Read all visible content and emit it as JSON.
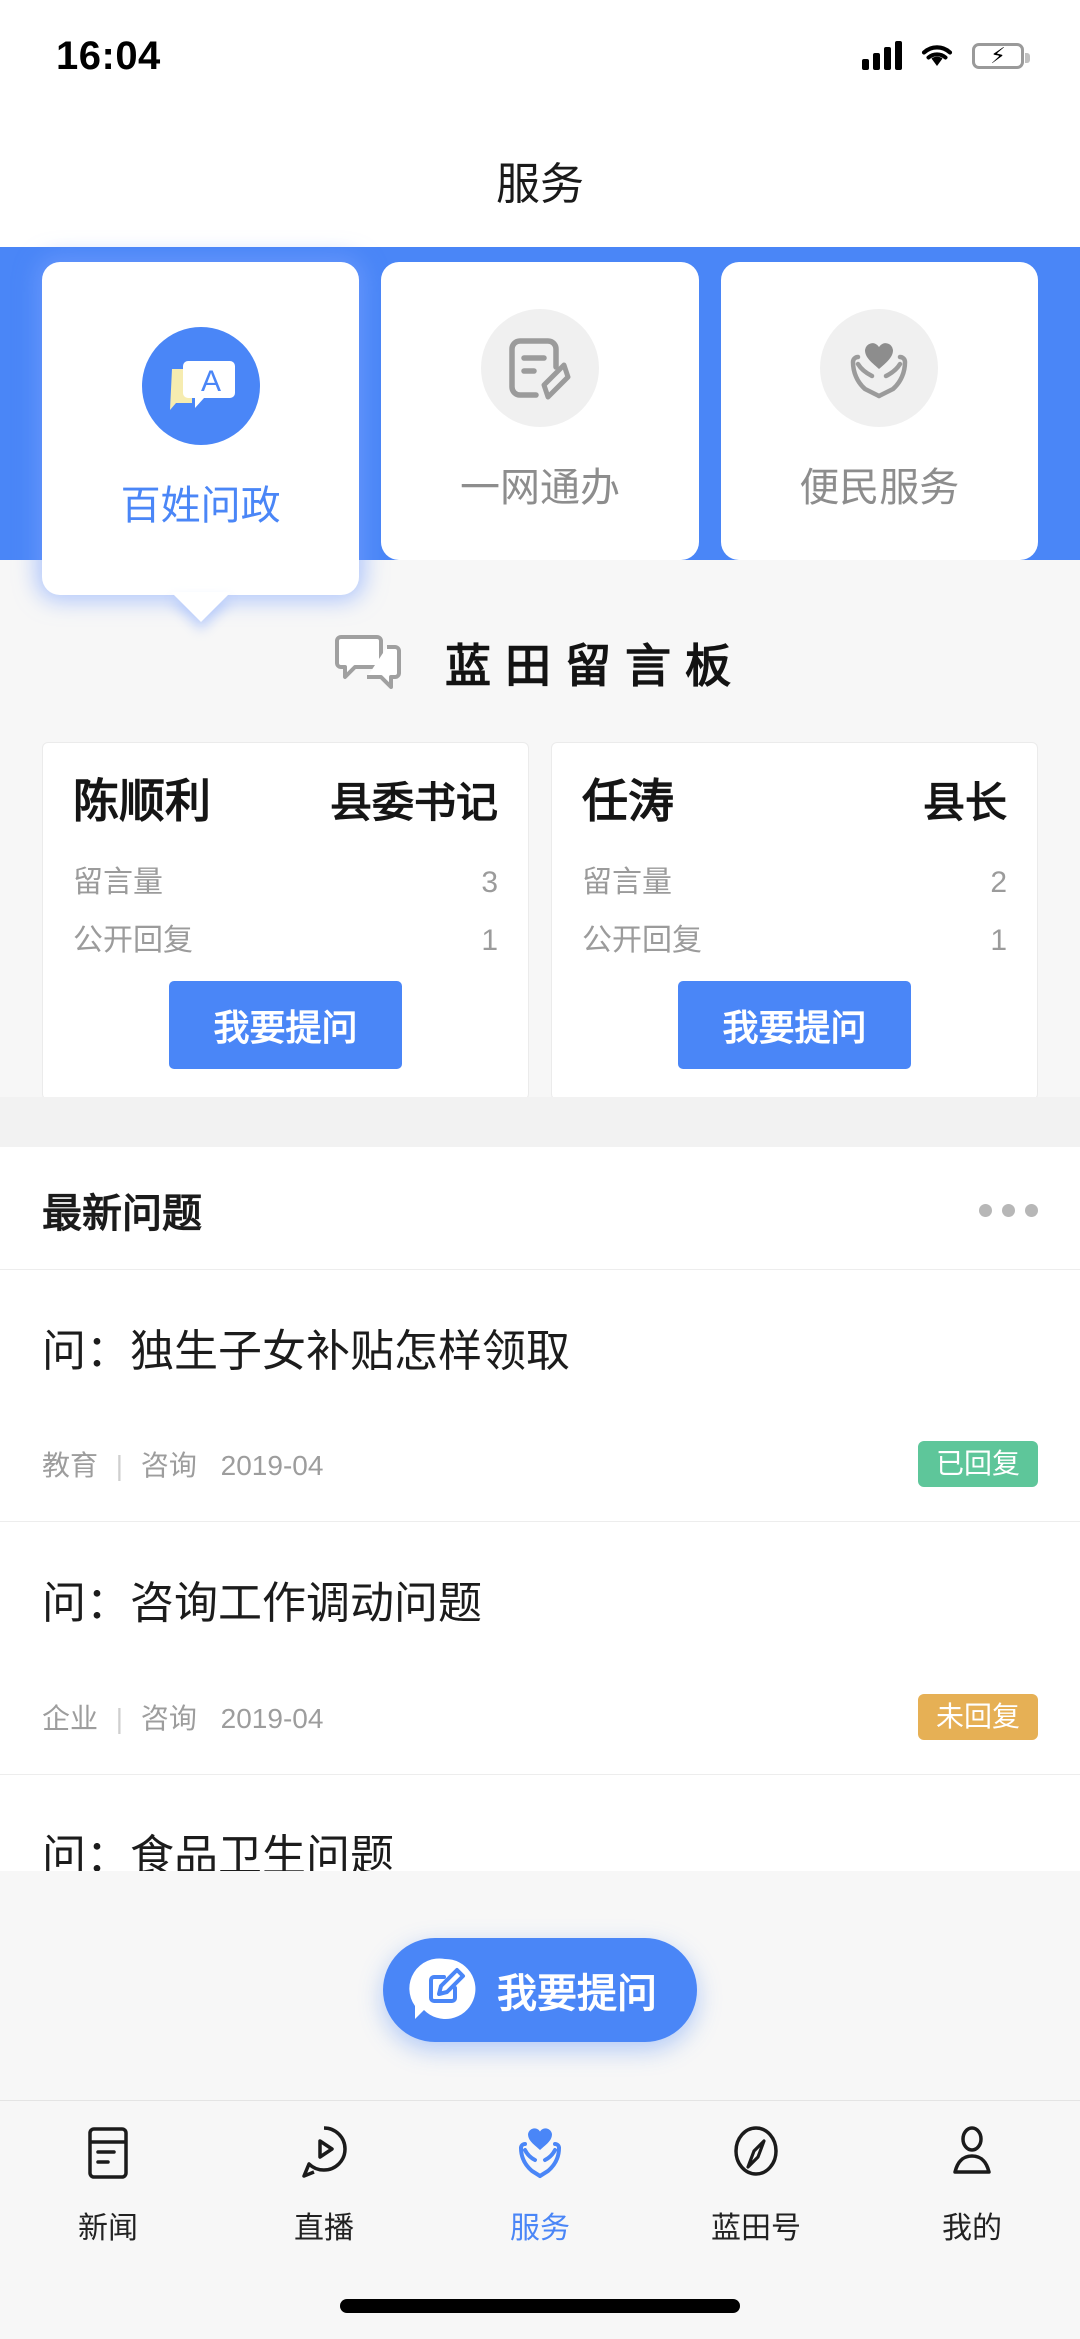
{
  "status_bar": {
    "time": "16:04",
    "signal_icon": "cellular-bars-icon",
    "wifi_icon": "wifi-icon",
    "battery_icon": "battery-charging-icon"
  },
  "nav": {
    "title": "服务"
  },
  "service_tabs": [
    {
      "label": "百姓问政",
      "icon": "speech-bubble-a-icon",
      "active": true
    },
    {
      "label": "一网通办",
      "icon": "document-pen-icon",
      "active": false
    },
    {
      "label": "便民服务",
      "icon": "heart-in-hands-icon",
      "active": false
    }
  ],
  "board": {
    "icon": "dual-speech-bubble-icon",
    "title": "蓝田留言板"
  },
  "leaders": [
    {
      "name": "陈顺利",
      "role": "县委书记",
      "stats": [
        {
          "label": "留言量",
          "value": "3"
        },
        {
          "label": "公开回复",
          "value": "1"
        }
      ],
      "button": "我要提问"
    },
    {
      "name": "任涛",
      "role": "县长",
      "stats": [
        {
          "label": "留言量",
          "value": "2"
        },
        {
          "label": "公开回复",
          "value": "1"
        }
      ],
      "button": "我要提问"
    }
  ],
  "latest": {
    "title": "最新问题",
    "more_icon": "more-dots-icon",
    "questions": [
      {
        "title": "问：独生子女补贴怎样领取",
        "category": "教育",
        "type": "咨询",
        "date": "2019-04",
        "status": "已回复",
        "status_color": "#5ec69a"
      },
      {
        "title": "问：咨询工作调动问题",
        "category": "企业",
        "type": "咨询",
        "date": "2019-04",
        "status": "未回复",
        "status_color": "#e6b055"
      },
      {
        "title": "问：食品卫生问题"
      }
    ]
  },
  "fab": {
    "label": "我要提问",
    "icon": "edit-bubble-icon"
  },
  "bottom_nav": [
    {
      "label": "新闻",
      "icon": "news-doc-icon",
      "active": false
    },
    {
      "label": "直播",
      "icon": "live-play-icon",
      "active": false
    },
    {
      "label": "服务",
      "icon": "heart-hands-icon",
      "active": true
    },
    {
      "label": "蓝田号",
      "icon": "compass-icon",
      "active": false
    },
    {
      "label": "我的",
      "icon": "person-icon",
      "active": false
    }
  ],
  "colors": {
    "accent": "#4a86f7",
    "answered": "#5ec69a",
    "pending": "#e6b055"
  }
}
